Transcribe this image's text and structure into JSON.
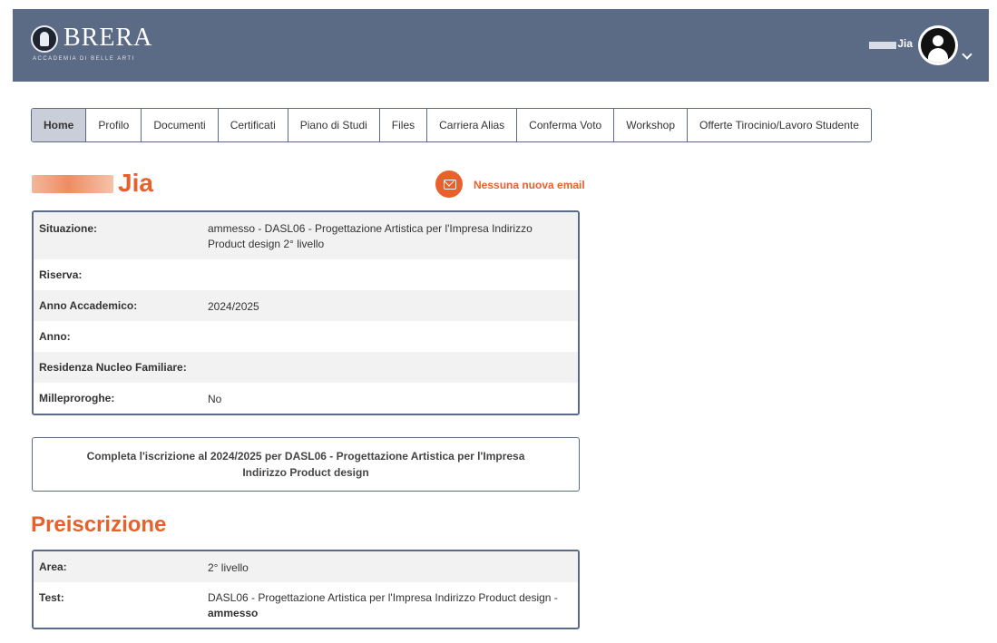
{
  "header": {
    "logo_text": "BRERA",
    "logo_sub": "ACCADEMIA DI BELLE ARTI",
    "user_name": "Jia"
  },
  "tabs": [
    {
      "label": "Home",
      "active": true
    },
    {
      "label": "Profilo"
    },
    {
      "label": "Documenti"
    },
    {
      "label": "Certificati"
    },
    {
      "label": "Piano di Studi"
    },
    {
      "label": "Files"
    },
    {
      "label": "Carriera Alias"
    },
    {
      "label": "Conferma Voto"
    },
    {
      "label": "Workshop"
    },
    {
      "label": "Offerte Tirocinio/Lavoro Studente"
    }
  ],
  "student": {
    "name": "Jia",
    "email_status": "Nessuna nuova email"
  },
  "info": [
    {
      "label": "Situazione:",
      "value": "ammesso - DASL06 - Progettazione Artistica per l'Impresa Indirizzo Product design 2° livello"
    },
    {
      "label": "Riserva:",
      "value": ""
    },
    {
      "label": "Anno Accademico:",
      "value": "2024/2025"
    },
    {
      "label": "Anno:",
      "value": ""
    },
    {
      "label": "Residenza Nucleo Familiare:",
      "value": ""
    },
    {
      "label": "Milleproroghe:",
      "value": "No"
    }
  ],
  "notice": "Completa l'iscrizione al 2024/2025 per DASL06 - Progettazione Artistica per l'Impresa Indirizzo Product design",
  "preiscrizione": {
    "title": "Preiscrizione",
    "rows": [
      {
        "label": "Area:",
        "value": "2° livello"
      },
      {
        "label": "Test:",
        "value": "DASL06 - Progettazione Artistica per l'Impresa Indirizzo Product design -",
        "value_bold": "ammesso"
      }
    ]
  },
  "colors": {
    "header_bg": "#5b6a85",
    "accent": "#e8612c",
    "active_tab": "#c9ced8"
  }
}
